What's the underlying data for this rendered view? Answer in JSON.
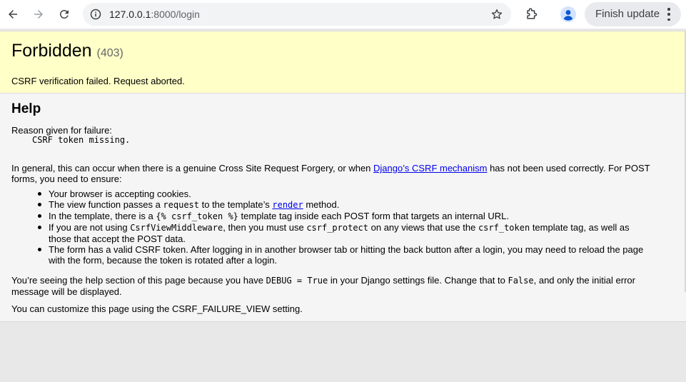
{
  "browser": {
    "url_host": "127.0.0.1",
    "url_path": ":8000/login",
    "update_label": "Finish update",
    "icons": [
      "back-arrow-icon",
      "forward-arrow-icon",
      "reload-icon",
      "site-info-icon",
      "bookmark-star-icon",
      "extensions-puzzle-icon",
      "profile-avatar-icon",
      "more-vert-icon"
    ]
  },
  "summary": {
    "title": "Forbidden",
    "status_code": "(403)",
    "message": "CSRF verification failed. Request aborted."
  },
  "help": {
    "heading": "Help",
    "reason_label": "Reason given for failure:",
    "reason": "CSRF token missing.",
    "para1_pre": "In general, this can occur when there is a genuine Cross Site Request Forgery, or when ",
    "para1_link": "Django’s CSRF mechanism",
    "para1_post": " has not been used correctly. For POST forms, you need to ensure:",
    "items": {
      "i1": "Your browser is accepting cookies.",
      "i2_a": "The view function passes a ",
      "i2_code": "request",
      "i2_b": " to the template’s ",
      "i2_link": "render",
      "i2_c": " method.",
      "i3_a": "In the template, there is a ",
      "i3_code": "{% csrf_token %}",
      "i3_b": " template tag inside each POST form that targets an internal URL.",
      "i4_a": "If you are not using ",
      "i4_code1": "CsrfViewMiddleware",
      "i4_b": ", then you must use ",
      "i4_code2": "csrf_protect",
      "i4_c": " on any views that use the ",
      "i4_code3": "csrf_token",
      "i4_d": " template tag, as well as those that accept the POST data.",
      "i5": "The form has a valid CSRF token. After logging in in another browser tab or hitting the back button after a login, you may need to reload the page with the form, because the token is rotated after a login."
    },
    "para2_a": "You’re seeing the help section of this page because you have ",
    "para2_code1": "DEBUG = True",
    "para2_b": " in your Django settings file. Change that to ",
    "para2_code2": "False",
    "para2_c": ", and only the initial error message will be displayed.",
    "para3": "You can customize this page using the CSRF_FAILURE_VIEW setting."
  }
}
